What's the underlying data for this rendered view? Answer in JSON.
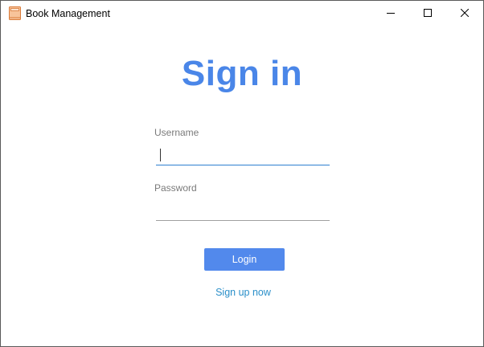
{
  "window": {
    "title": "Book Management",
    "icon": "book-icon",
    "controls": [
      "minimize-icon",
      "maximize-icon",
      "close-icon"
    ]
  },
  "login": {
    "heading": "Sign in",
    "username_label": "Username",
    "username_value": "",
    "password_label": "Password",
    "password_value": "",
    "login_button": "Login",
    "signup_link": "Sign up now"
  },
  "colors": {
    "accent": "#4a86e8",
    "button": "#5289ec",
    "link": "#2a8fc9",
    "focused_underline": "#2f7fd0"
  }
}
